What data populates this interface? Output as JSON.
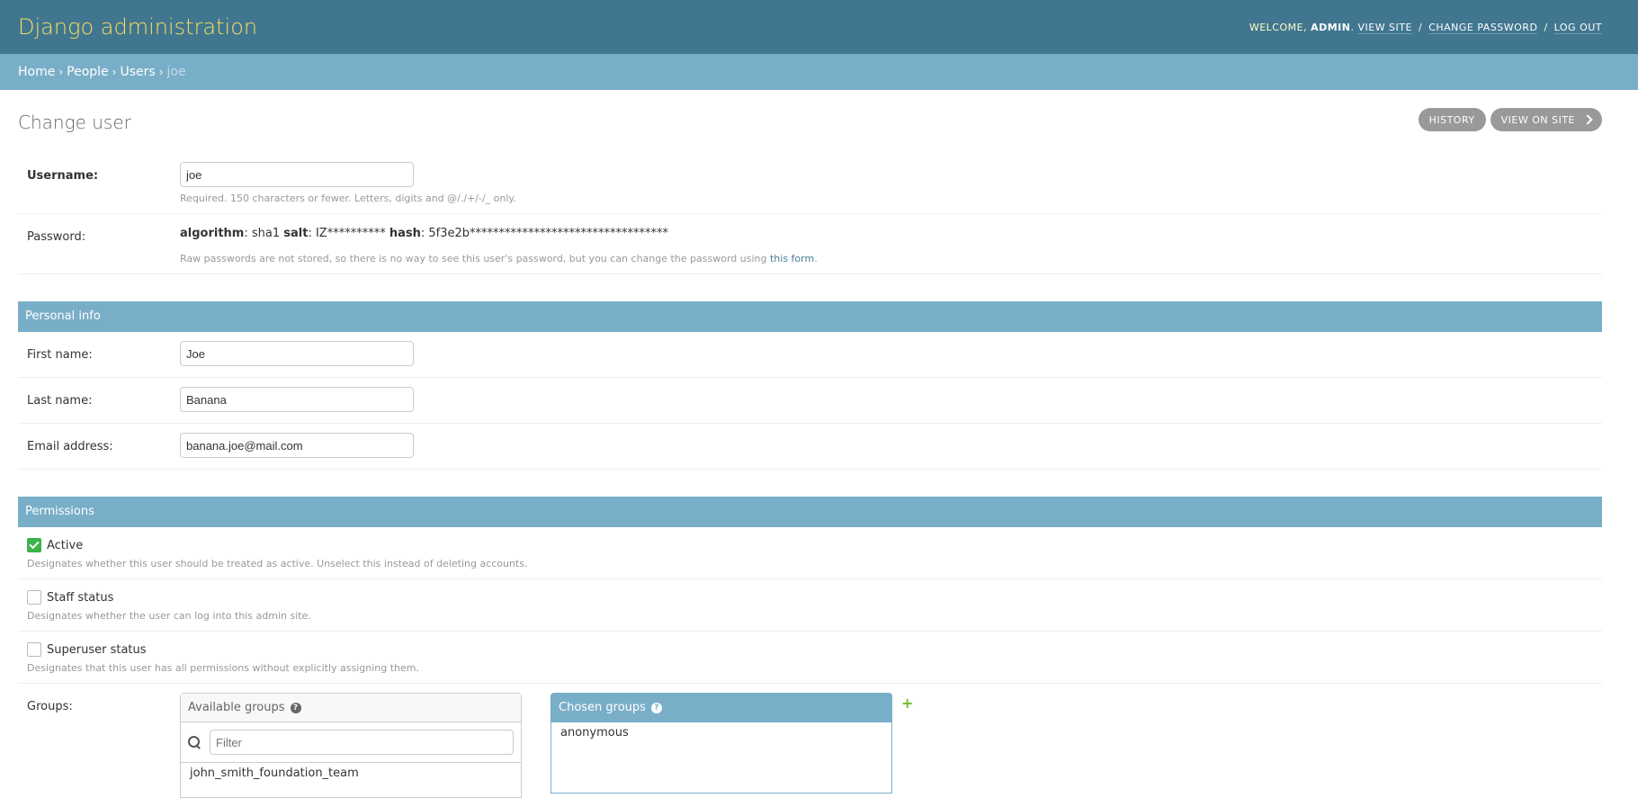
{
  "header": {
    "branding": "Django administration",
    "welcome": "WELCOME,",
    "user": "ADMIN",
    "links": [
      "VIEW SITE",
      "CHANGE PASSWORD",
      "LOG OUT"
    ]
  },
  "breadcrumbs": {
    "items": [
      "Home",
      "People",
      "Users"
    ],
    "current": "joe"
  },
  "page": {
    "title": "Change user",
    "tools": [
      "HISTORY",
      "VIEW ON SITE"
    ]
  },
  "username": {
    "label": "Username:",
    "value": "joe",
    "help": "Required. 150 characters or fewer. Letters, digits and @/./+/-/_ only."
  },
  "password": {
    "label": "Password:",
    "algorithm_label": "algorithm",
    "algorithm": ": sha1 ",
    "salt_label": "salt",
    "salt": ": IZ********** ",
    "hash_label": "hash",
    "hash": ": 5f3e2b**********************************",
    "help_prefix": "Raw passwords are not stored, so there is no way to see this user's password, but you can change the password using ",
    "help_link": "this form",
    "help_suffix": "."
  },
  "personal_info": {
    "title": "Personal info",
    "first_name_label": "First name:",
    "first_name": "Joe",
    "last_name_label": "Last name:",
    "last_name": "Banana",
    "email_label": "Email address:",
    "email": "banana.joe@mail.com"
  },
  "permissions": {
    "title": "Permissions",
    "active_label": "Active",
    "active_help": "Designates whether this user should be treated as active. Unselect this instead of deleting accounts.",
    "active_checked": true,
    "staff_label": "Staff status",
    "staff_help": "Designates whether the user can log into this admin site.",
    "staff_checked": false,
    "superuser_label": "Superuser status",
    "superuser_help": "Designates that this user has all permissions without explicitly assigning them.",
    "superuser_checked": false,
    "groups_label": "Groups:",
    "available_title": "Available groups",
    "filter_placeholder": "Filter",
    "available_items": [
      "john_smith_foundation_team"
    ],
    "chosen_title": "Chosen groups",
    "chosen_items": [
      "anonymous"
    ]
  },
  "colors": {
    "header": "#417690",
    "breadcrumbs": "#79aec8",
    "branding": "#f5dd5d",
    "check": "#3bb34a"
  }
}
